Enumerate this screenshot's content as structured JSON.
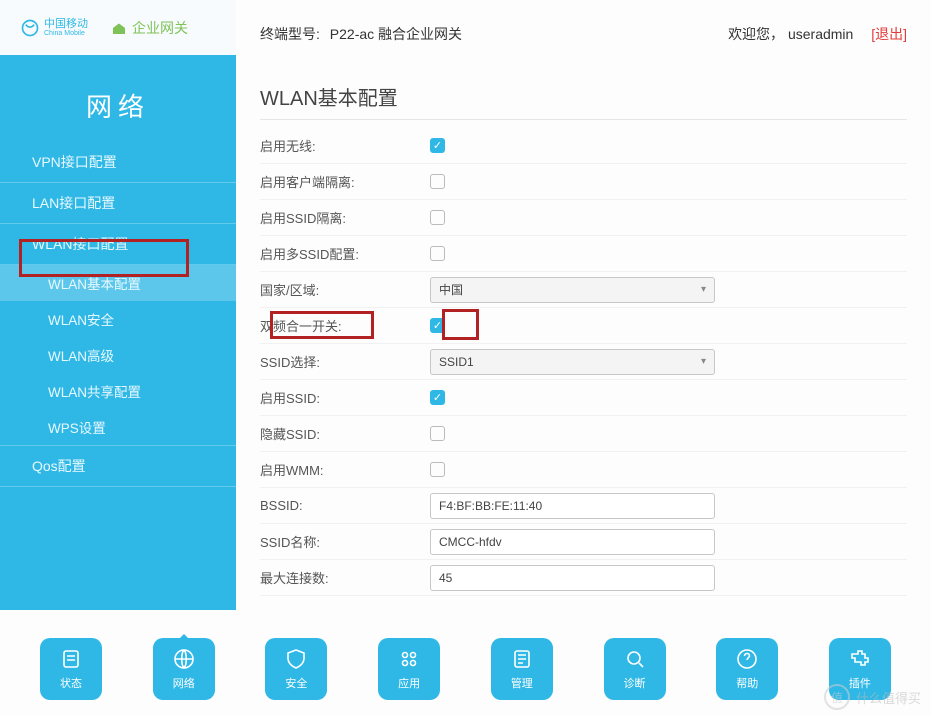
{
  "brand": {
    "cm_top": "中国移动",
    "cm_bottom": "China Mobile",
    "gw": "企业网关"
  },
  "sidebar": {
    "title": "网络",
    "items": [
      {
        "label": "VPN接口配置"
      },
      {
        "label": "LAN接口配置"
      },
      {
        "label": "WLAN接口配置"
      },
      {
        "label": "WLAN基本配置",
        "sub": true,
        "selected": true
      },
      {
        "label": "WLAN安全",
        "sub": true
      },
      {
        "label": "WLAN高级",
        "sub": true
      },
      {
        "label": "WLAN共享配置",
        "sub": true
      },
      {
        "label": "WPS设置",
        "sub": true
      },
      {
        "label": "Qos配置"
      }
    ]
  },
  "topbar": {
    "model_label": "终端型号:",
    "model_value": "P22-ac 融合企业网关",
    "welcome_prefix": "欢迎您，",
    "username": "useradmin",
    "logout": "[退出]"
  },
  "page_title": "WLAN基本配置",
  "rows": {
    "enable_wireless": {
      "label": "启用无线:",
      "checked": true
    },
    "client_isolation": {
      "label": "启用客户端隔离:",
      "checked": false
    },
    "ssid_isolation": {
      "label": "启用SSID隔离:",
      "checked": false
    },
    "multi_ssid": {
      "label": "启用多SSID配置:",
      "checked": false
    },
    "country": {
      "label": "国家/区域:",
      "value": "中国"
    },
    "dual_band": {
      "label": "双频合一开关:",
      "checked": true
    },
    "ssid_select": {
      "label": "SSID选择:",
      "value": "SSID1"
    },
    "enable_ssid": {
      "label": "启用SSID:",
      "checked": true
    },
    "hide_ssid": {
      "label": "隐藏SSID:",
      "checked": false
    },
    "enable_wmm": {
      "label": "启用WMM:",
      "checked": false
    },
    "bssid": {
      "label": "BSSID:",
      "value": "F4:BF:BB:FE:11:40"
    },
    "ssid_name": {
      "label": "SSID名称:",
      "value": "CMCC-hfdv"
    },
    "max_conn": {
      "label": "最大连接数:",
      "value": "45"
    }
  },
  "bottom_nav": [
    {
      "label": "状态"
    },
    {
      "label": "网络",
      "active": true
    },
    {
      "label": "安全"
    },
    {
      "label": "应用"
    },
    {
      "label": "管理"
    },
    {
      "label": "诊断"
    },
    {
      "label": "帮助"
    },
    {
      "label": "插件"
    }
  ],
  "watermark": {
    "text": "什么值得买",
    "badge": "值"
  }
}
